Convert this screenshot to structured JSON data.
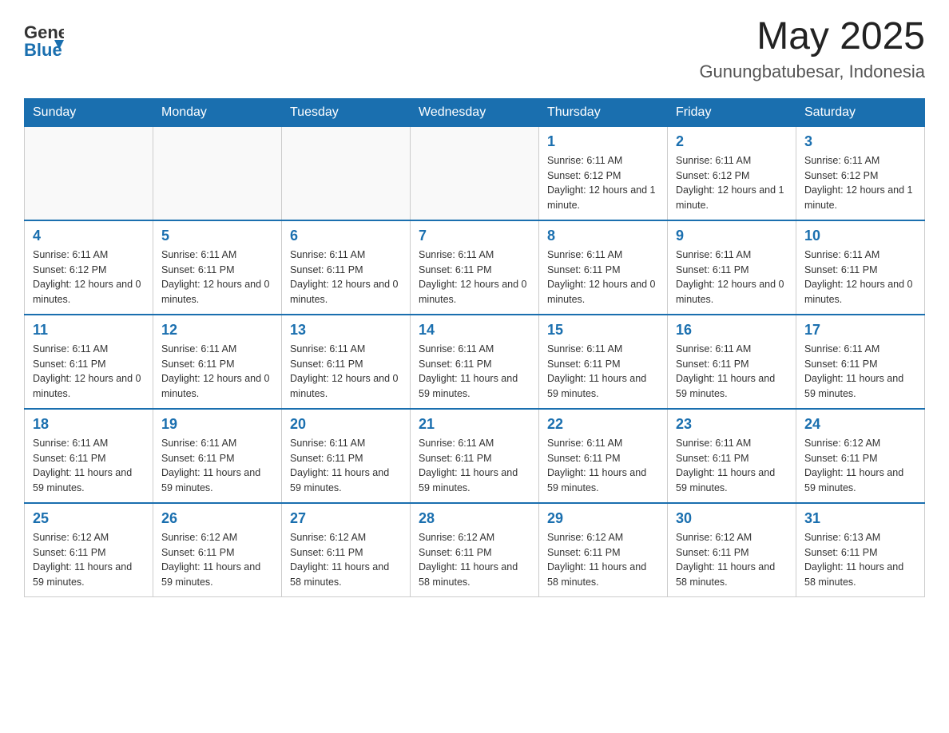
{
  "header": {
    "logo_general": "General",
    "logo_blue": "Blue",
    "month_year": "May 2025",
    "location": "Gunungbatubesar, Indonesia"
  },
  "weekdays": [
    "Sunday",
    "Monday",
    "Tuesday",
    "Wednesday",
    "Thursday",
    "Friday",
    "Saturday"
  ],
  "weeks": [
    [
      {
        "day": "",
        "info": ""
      },
      {
        "day": "",
        "info": ""
      },
      {
        "day": "",
        "info": ""
      },
      {
        "day": "",
        "info": ""
      },
      {
        "day": "1",
        "info": "Sunrise: 6:11 AM\nSunset: 6:12 PM\nDaylight: 12 hours and 1 minute."
      },
      {
        "day": "2",
        "info": "Sunrise: 6:11 AM\nSunset: 6:12 PM\nDaylight: 12 hours and 1 minute."
      },
      {
        "day": "3",
        "info": "Sunrise: 6:11 AM\nSunset: 6:12 PM\nDaylight: 12 hours and 1 minute."
      }
    ],
    [
      {
        "day": "4",
        "info": "Sunrise: 6:11 AM\nSunset: 6:12 PM\nDaylight: 12 hours and 0 minutes."
      },
      {
        "day": "5",
        "info": "Sunrise: 6:11 AM\nSunset: 6:11 PM\nDaylight: 12 hours and 0 minutes."
      },
      {
        "day": "6",
        "info": "Sunrise: 6:11 AM\nSunset: 6:11 PM\nDaylight: 12 hours and 0 minutes."
      },
      {
        "day": "7",
        "info": "Sunrise: 6:11 AM\nSunset: 6:11 PM\nDaylight: 12 hours and 0 minutes."
      },
      {
        "day": "8",
        "info": "Sunrise: 6:11 AM\nSunset: 6:11 PM\nDaylight: 12 hours and 0 minutes."
      },
      {
        "day": "9",
        "info": "Sunrise: 6:11 AM\nSunset: 6:11 PM\nDaylight: 12 hours and 0 minutes."
      },
      {
        "day": "10",
        "info": "Sunrise: 6:11 AM\nSunset: 6:11 PM\nDaylight: 12 hours and 0 minutes."
      }
    ],
    [
      {
        "day": "11",
        "info": "Sunrise: 6:11 AM\nSunset: 6:11 PM\nDaylight: 12 hours and 0 minutes."
      },
      {
        "day": "12",
        "info": "Sunrise: 6:11 AM\nSunset: 6:11 PM\nDaylight: 12 hours and 0 minutes."
      },
      {
        "day": "13",
        "info": "Sunrise: 6:11 AM\nSunset: 6:11 PM\nDaylight: 12 hours and 0 minutes."
      },
      {
        "day": "14",
        "info": "Sunrise: 6:11 AM\nSunset: 6:11 PM\nDaylight: 11 hours and 59 minutes."
      },
      {
        "day": "15",
        "info": "Sunrise: 6:11 AM\nSunset: 6:11 PM\nDaylight: 11 hours and 59 minutes."
      },
      {
        "day": "16",
        "info": "Sunrise: 6:11 AM\nSunset: 6:11 PM\nDaylight: 11 hours and 59 minutes."
      },
      {
        "day": "17",
        "info": "Sunrise: 6:11 AM\nSunset: 6:11 PM\nDaylight: 11 hours and 59 minutes."
      }
    ],
    [
      {
        "day": "18",
        "info": "Sunrise: 6:11 AM\nSunset: 6:11 PM\nDaylight: 11 hours and 59 minutes."
      },
      {
        "day": "19",
        "info": "Sunrise: 6:11 AM\nSunset: 6:11 PM\nDaylight: 11 hours and 59 minutes."
      },
      {
        "day": "20",
        "info": "Sunrise: 6:11 AM\nSunset: 6:11 PM\nDaylight: 11 hours and 59 minutes."
      },
      {
        "day": "21",
        "info": "Sunrise: 6:11 AM\nSunset: 6:11 PM\nDaylight: 11 hours and 59 minutes."
      },
      {
        "day": "22",
        "info": "Sunrise: 6:11 AM\nSunset: 6:11 PM\nDaylight: 11 hours and 59 minutes."
      },
      {
        "day": "23",
        "info": "Sunrise: 6:11 AM\nSunset: 6:11 PM\nDaylight: 11 hours and 59 minutes."
      },
      {
        "day": "24",
        "info": "Sunrise: 6:12 AM\nSunset: 6:11 PM\nDaylight: 11 hours and 59 minutes."
      }
    ],
    [
      {
        "day": "25",
        "info": "Sunrise: 6:12 AM\nSunset: 6:11 PM\nDaylight: 11 hours and 59 minutes."
      },
      {
        "day": "26",
        "info": "Sunrise: 6:12 AM\nSunset: 6:11 PM\nDaylight: 11 hours and 59 minutes."
      },
      {
        "day": "27",
        "info": "Sunrise: 6:12 AM\nSunset: 6:11 PM\nDaylight: 11 hours and 58 minutes."
      },
      {
        "day": "28",
        "info": "Sunrise: 6:12 AM\nSunset: 6:11 PM\nDaylight: 11 hours and 58 minutes."
      },
      {
        "day": "29",
        "info": "Sunrise: 6:12 AM\nSunset: 6:11 PM\nDaylight: 11 hours and 58 minutes."
      },
      {
        "day": "30",
        "info": "Sunrise: 6:12 AM\nSunset: 6:11 PM\nDaylight: 11 hours and 58 minutes."
      },
      {
        "day": "31",
        "info": "Sunrise: 6:13 AM\nSunset: 6:11 PM\nDaylight: 11 hours and 58 minutes."
      }
    ]
  ]
}
